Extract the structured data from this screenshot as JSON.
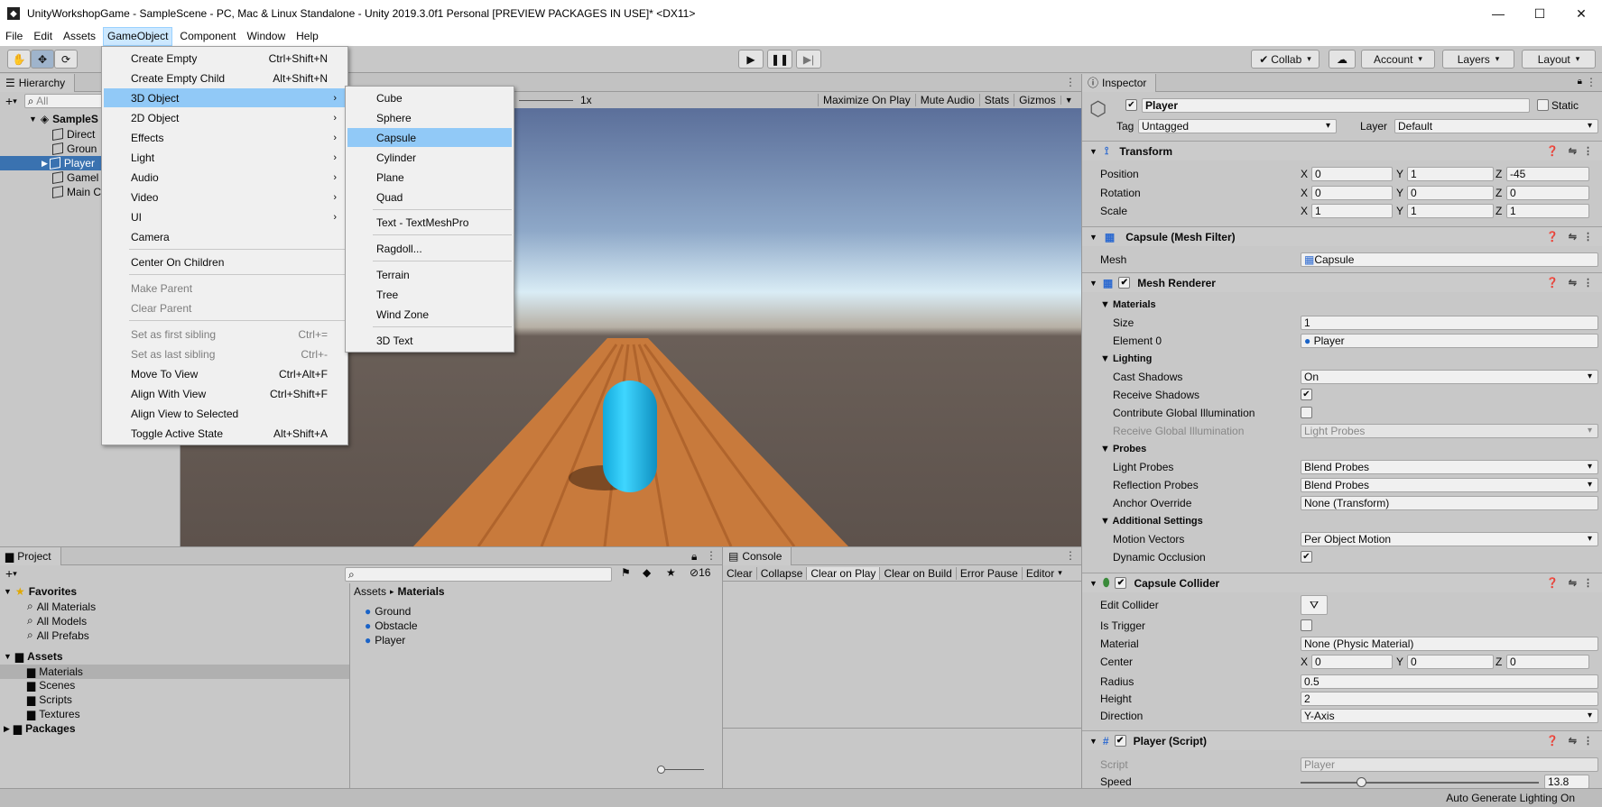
{
  "window": {
    "title": "UnityWorkshopGame - SampleScene - PC, Mac & Linux Standalone - Unity 2019.3.0f1 Personal [PREVIEW PACKAGES IN USE]* <DX11>",
    "minimize": "—",
    "maximize": "☐",
    "close": "✕"
  },
  "menubar": [
    "File",
    "Edit",
    "Assets",
    "GameObject",
    "Component",
    "Window",
    "Help"
  ],
  "toolbar": {
    "collab": "Collab",
    "account": "Account",
    "layers": "Layers",
    "layout": "Layout"
  },
  "hierarchy": {
    "tab": "Hierarchy",
    "search_placeholder": "All",
    "scene": "SampleS",
    "items": [
      "Direct",
      "Groun",
      "Player",
      "Gamel",
      "Main C"
    ]
  },
  "scene_toolbar": {
    "scale": "1x",
    "maximize": "Maximize On Play",
    "mute": "Mute Audio",
    "stats": "Stats",
    "gizmos": "Gizmos"
  },
  "gameobject_menu": {
    "items": [
      {
        "label": "Create Empty",
        "shortcut": "Ctrl+Shift+N"
      },
      {
        "label": "Create Empty Child",
        "shortcut": "Alt+Shift+N"
      },
      {
        "label": "3D Object",
        "shortcut": ""
      },
      {
        "label": "2D Object",
        "shortcut": ""
      },
      {
        "label": "Effects",
        "shortcut": ""
      },
      {
        "label": "Light",
        "shortcut": ""
      },
      {
        "label": "Audio",
        "shortcut": ""
      },
      {
        "label": "Video",
        "shortcut": ""
      },
      {
        "label": "UI",
        "shortcut": ""
      },
      {
        "label": "Camera",
        "shortcut": ""
      },
      {
        "label": "Center On Children",
        "shortcut": ""
      },
      {
        "label": "Make Parent",
        "shortcut": ""
      },
      {
        "label": "Clear Parent",
        "shortcut": ""
      },
      {
        "label": "Set as first sibling",
        "shortcut": "Ctrl+="
      },
      {
        "label": "Set as last sibling",
        "shortcut": "Ctrl+-"
      },
      {
        "label": "Move To View",
        "shortcut": "Ctrl+Alt+F"
      },
      {
        "label": "Align With View",
        "shortcut": "Ctrl+Shift+F"
      },
      {
        "label": "Align View to Selected",
        "shortcut": ""
      },
      {
        "label": "Toggle Active State",
        "shortcut": "Alt+Shift+A"
      }
    ]
  },
  "submenu_3d": {
    "items": [
      "Cube",
      "Sphere",
      "Capsule",
      "Cylinder",
      "Plane",
      "Quad",
      "Text - TextMeshPro",
      "Ragdoll...",
      "Terrain",
      "Tree",
      "Wind Zone",
      "3D Text"
    ]
  },
  "project": {
    "tab": "Project",
    "favorites": "Favorites",
    "fav_items": [
      "All Materials",
      "All Models",
      "All Prefabs"
    ],
    "assets": "Assets",
    "asset_folders": [
      "Materials",
      "Scenes",
      "Scripts",
      "Textures"
    ],
    "packages": "Packages",
    "breadcrumb_root": "Assets",
    "breadcrumb_sep": "▸",
    "breadcrumb_current": "Materials",
    "files": [
      "Ground",
      "Obstacle",
      "Player"
    ],
    "hidden_count": "16"
  },
  "console": {
    "tab": "Console",
    "buttons": [
      "Clear",
      "Collapse",
      "Clear on Play",
      "Clear on Build",
      "Error Pause",
      "Editor"
    ]
  },
  "inspector": {
    "tab": "Inspector",
    "object_name": "Player",
    "static": "Static",
    "tag_label": "Tag",
    "tag": "Untagged",
    "layer_label": "Layer",
    "layer": "Default",
    "transform": {
      "title": "Transform",
      "position_label": "Position",
      "position": [
        "0",
        "1",
        "-45"
      ],
      "rotation_label": "Rotation",
      "rotation": [
        "0",
        "0",
        "0"
      ],
      "scale_label": "Scale",
      "scale": [
        "1",
        "1",
        "1"
      ]
    },
    "mesh_filter": {
      "title": "Capsule (Mesh Filter)",
      "mesh_label": "Mesh",
      "mesh": "Capsule"
    },
    "mesh_renderer": {
      "title": "Mesh Renderer",
      "materials": "Materials",
      "size_label": "Size",
      "size": "1",
      "element0_label": "Element 0",
      "element0": "Player",
      "lighting": "Lighting",
      "cast_shadows_label": "Cast Shadows",
      "cast_shadows": "On",
      "receive_shadows": "Receive Shadows",
      "contribute_gi": "Contribute Global Illumination",
      "receive_gi_label": "Receive Global Illumination",
      "receive_gi": "Light Probes",
      "probes": "Probes",
      "light_probes_label": "Light Probes",
      "light_probes": "Blend Probes",
      "reflection_probes_label": "Reflection Probes",
      "reflection_probes": "Blend Probes",
      "anchor_override_label": "Anchor Override",
      "anchor_override": "None (Transform)",
      "additional": "Additional Settings",
      "motion_vectors_label": "Motion Vectors",
      "motion_vectors": "Per Object Motion",
      "dynamic_occlusion": "Dynamic Occlusion"
    },
    "capsule_collider": {
      "title": "Capsule Collider",
      "edit_collider": "Edit Collider",
      "is_trigger": "Is Trigger",
      "material_label": "Material",
      "material": "None (Physic Material)",
      "center_label": "Center",
      "center": [
        "0",
        "0",
        "0"
      ],
      "radius_label": "Radius",
      "radius": "0.5",
      "height_label": "Height",
      "height": "2",
      "direction_label": "Direction",
      "direction": "Y-Axis"
    },
    "player_script": {
      "title": "Player (Script)",
      "script_label": "Script",
      "script": "Player",
      "speed_label": "Speed",
      "speed": "13.8"
    }
  },
  "status": "Auto Generate Lighting On",
  "colors": {
    "selection": "#3a72b0",
    "menu_highlight": "#91c9f7",
    "capsule": "#1fc8f5",
    "road": "#c87a3c"
  }
}
